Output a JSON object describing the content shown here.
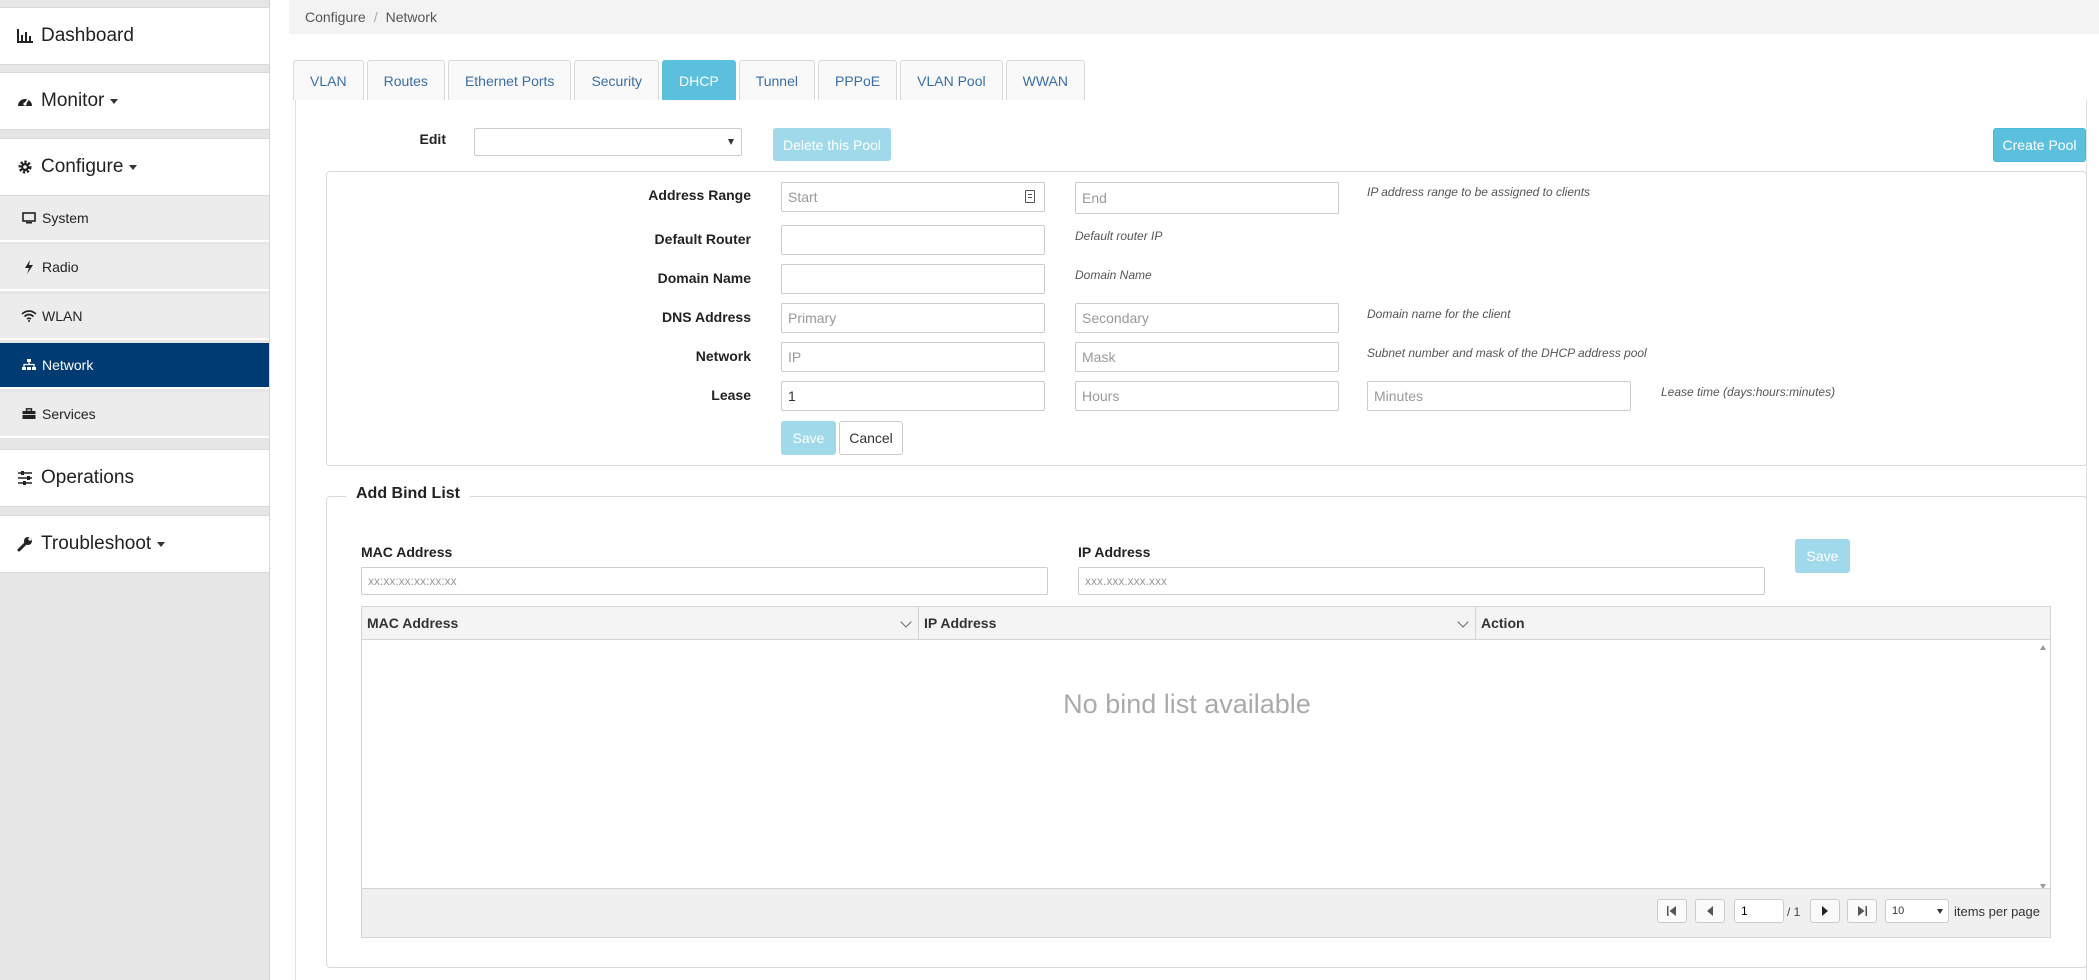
{
  "sidebar": {
    "top_items": [
      {
        "label": "Dashboard",
        "icon": "bar-chart-icon"
      },
      {
        "label": "Monitor",
        "icon": "speedometer-icon"
      },
      {
        "label": "Configure",
        "icon": "gear-icon"
      },
      {
        "label": "Operations",
        "icon": "sliders-icon"
      },
      {
        "label": "Troubleshoot",
        "icon": "wrench-icon"
      }
    ],
    "configure_items": [
      {
        "label": "System",
        "icon": "monitor-icon"
      },
      {
        "label": "Radio",
        "icon": "bolt-icon"
      },
      {
        "label": "WLAN",
        "icon": "wifi-icon"
      },
      {
        "label": "Network",
        "icon": "sitemap-icon"
      },
      {
        "label": "Services",
        "icon": "briefcase-icon"
      }
    ],
    "active_item": "Network",
    "active_color": "#003b73"
  },
  "breadcrumb": {
    "parent": "Configure",
    "separator": "/",
    "current": "Network"
  },
  "tabs": [
    "VLAN",
    "Routes",
    "Ethernet Ports",
    "Security",
    "DHCP",
    "Tunnel",
    "PPPoE",
    "VLAN Pool",
    "WWAN"
  ],
  "active_tab": "DHCP",
  "pool": {
    "edit_label": "Edit",
    "edit_value": "",
    "delete_button": "Delete this Pool",
    "create_button": "Create Pool"
  },
  "form": {
    "address_range": {
      "label": "Address Range",
      "start_placeholder": "Start",
      "end_placeholder": "End",
      "hint": "IP address range to be assigned to clients"
    },
    "default_router": {
      "label": "Default Router",
      "value": "",
      "hint": "Default router IP"
    },
    "domain_name": {
      "label": "Domain Name",
      "value": "",
      "hint": "Domain Name"
    },
    "dns_address": {
      "label": "DNS Address",
      "primary_placeholder": "Primary",
      "secondary_placeholder": "Secondary",
      "hint": "Domain name for the client"
    },
    "network": {
      "label": "Network",
      "ip_placeholder": "IP",
      "mask_placeholder": "Mask",
      "hint": "Subnet number and mask of the DHCP address pool"
    },
    "lease": {
      "label": "Lease",
      "days_value": "1",
      "hours_placeholder": "Hours",
      "minutes_placeholder": "Minutes",
      "hint": "Lease time (days:hours:minutes)"
    },
    "save_button": "Save",
    "cancel_button": "Cancel"
  },
  "bind_list": {
    "title": "Add Bind List",
    "mac_label": "MAC Address",
    "mac_placeholder": "xx:xx:xx:xx:xx:xx",
    "ip_label": "IP Address",
    "ip_placeholder": "xxx.xxx.xxx.xxx",
    "save_button": "Save",
    "columns": [
      "MAC Address",
      "IP Address",
      "Action"
    ],
    "empty_message": "No bind list available",
    "pagination": {
      "page": "1",
      "of_label": "/ 1",
      "page_size": "10",
      "items_label": "items per page"
    }
  },
  "colors": {
    "accent": "#5bc0de",
    "sidebar_active": "#003b73"
  }
}
